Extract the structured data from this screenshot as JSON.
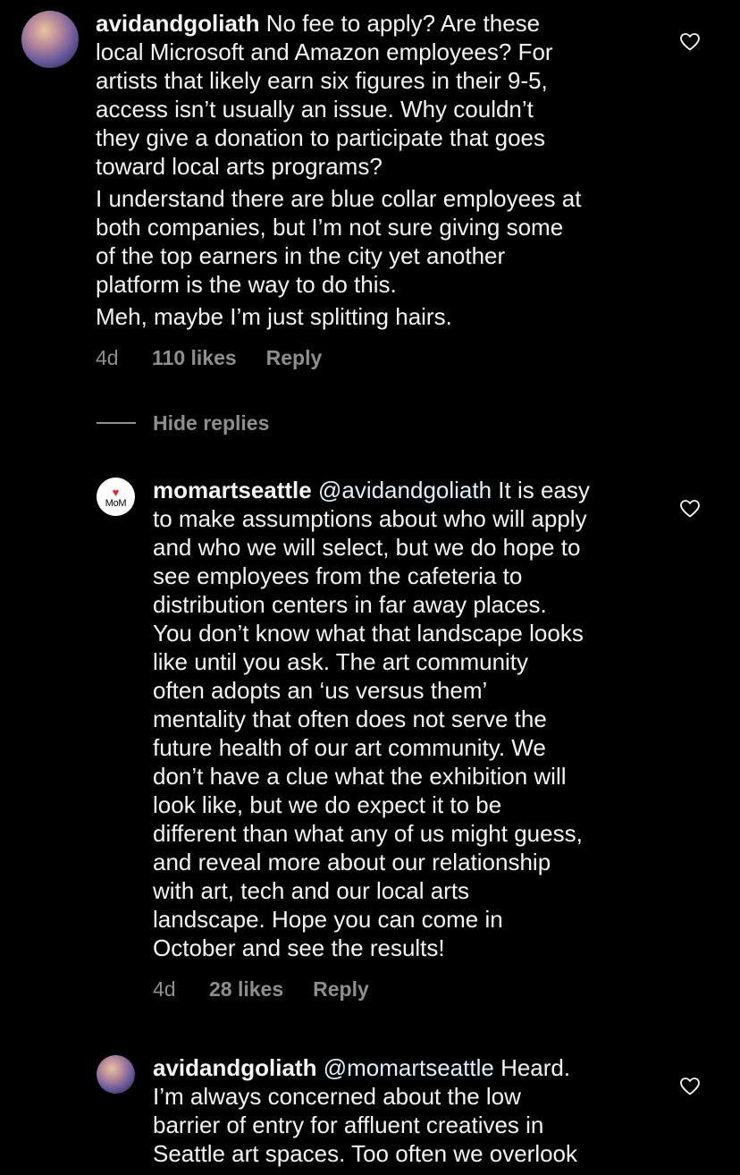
{
  "comments": [
    {
      "username": "avidandgoliath",
      "paragraphs": [
        "No fee to apply? Are these\nlocal Microsoft and Amazon employees? For\nartists that likely earn six figures in their 9-5,\naccess isn’t usually an issue. Why couldn’t\nthey give a donation to participate that goes\ntoward local arts programs?",
        "I understand there are blue collar employees at\nboth companies, but I’m not sure giving some\nof the top earners in the city yet another\nplatform is the way to do this.",
        "Meh, maybe I’m just splitting hairs."
      ],
      "time": "4d",
      "likes": "110 likes",
      "reply": "Reply"
    }
  ],
  "hide_replies": "Hide replies",
  "replies": [
    {
      "username": "momartseattle",
      "avatar_text": "MoM",
      "avatar_heart": "♥",
      "mention": "@avidandgoliath",
      "text": "It is easy\nto make assumptions about who will apply\nand who we will select, but we do hope to\nsee employees from the cafeteria to\ndistribution centers in far away places.\nYou don’t know what that landscape looks\nlike until you ask. The art community\noften adopts an ‘us versus them’\nmentality that often does not serve the\nfuture health of our art community. We\ndon’t have a clue what the exhibition will\nlook like, but we do expect it to be\ndifferent than what any of us might guess,\nand reveal more about our relationship\nwith art, tech and our local arts\nlandscape. Hope you can come in\nOctober and see the results!",
      "time": "4d",
      "likes": "28 likes",
      "reply": "Reply"
    },
    {
      "username": "avidandgoliath",
      "mention": "@momartseattle",
      "text": "Heard.\nI’m always concerned about the low\nbarrier of entry for affluent creatives in\nSeattle art spaces. Too often we overlook"
    }
  ],
  "colors": {
    "background": "#000000",
    "text": "#f5f5f5",
    "meta": "#8e8e8e",
    "mention": "#e0f1ff",
    "heart_logo": "#e0262b"
  }
}
